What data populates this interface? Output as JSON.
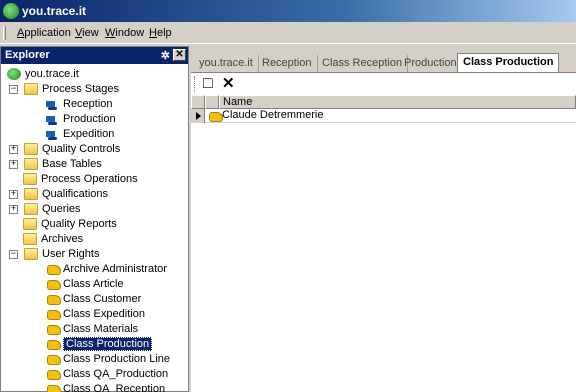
{
  "window": {
    "title": "you.trace.it"
  },
  "menu": [
    {
      "label": "Application",
      "u": "A"
    },
    {
      "label": "View",
      "u": "V"
    },
    {
      "label": "Window",
      "u": "W"
    },
    {
      "label": "Help",
      "u": "H"
    }
  ],
  "explorer": {
    "title": "Explorer",
    "pin_glyph": "✲",
    "close_glyph": "✕",
    "tree": [
      {
        "label": "you.trace.it",
        "icon": "app",
        "level": 0
      },
      {
        "label": "Process Stages",
        "icon": "folder",
        "level": 1,
        "expander": "−"
      },
      {
        "label": "Reception",
        "icon": "truck",
        "level": 2
      },
      {
        "label": "Production",
        "icon": "truck",
        "level": 2
      },
      {
        "label": "Expedition",
        "icon": "truck",
        "level": 2
      },
      {
        "label": "Quality Controls",
        "icon": "folder",
        "level": 1,
        "expander": "+"
      },
      {
        "label": "Base Tables",
        "icon": "folder",
        "level": 1,
        "expander": "+"
      },
      {
        "label": "Process Operations",
        "icon": "folder",
        "level": 1
      },
      {
        "label": "Qualifications",
        "icon": "folder",
        "level": 1,
        "expander": "+"
      },
      {
        "label": "Queries",
        "icon": "folder",
        "level": 1,
        "expander": "+"
      },
      {
        "label": "Quality Reports",
        "icon": "folder",
        "level": 1
      },
      {
        "label": "Archives",
        "icon": "folder",
        "level": 1
      },
      {
        "label": "User Rights",
        "icon": "folder",
        "level": 1,
        "expander": "−"
      },
      {
        "label": "Archive Administrator",
        "icon": "hand",
        "level": 2
      },
      {
        "label": "Class Article",
        "icon": "hand",
        "level": 2
      },
      {
        "label": "Class Customer",
        "icon": "hand",
        "level": 2
      },
      {
        "label": "Class Expedition",
        "icon": "hand",
        "level": 2
      },
      {
        "label": "Class Materials",
        "icon": "hand",
        "level": 2
      },
      {
        "label": "Class Production",
        "icon": "hand",
        "level": 2,
        "selected": true
      },
      {
        "label": "Class Production Line",
        "icon": "hand",
        "level": 2
      },
      {
        "label": "Class QA_Production",
        "icon": "hand",
        "level": 2
      },
      {
        "label": "Class QA_Reception",
        "icon": "hand",
        "level": 2
      }
    ]
  },
  "tabs": [
    {
      "label": "you.trace.it"
    },
    {
      "label": "Reception"
    },
    {
      "label": "Class Reception"
    },
    {
      "label": "Production"
    },
    {
      "label": "Class Production",
      "active": true
    }
  ],
  "toolbar": {
    "new_glyph": "□",
    "delete_glyph": "✕"
  },
  "grid": {
    "columns": [
      "Name"
    ],
    "rows": [
      {
        "name": "Claude Detremmerie"
      }
    ]
  }
}
